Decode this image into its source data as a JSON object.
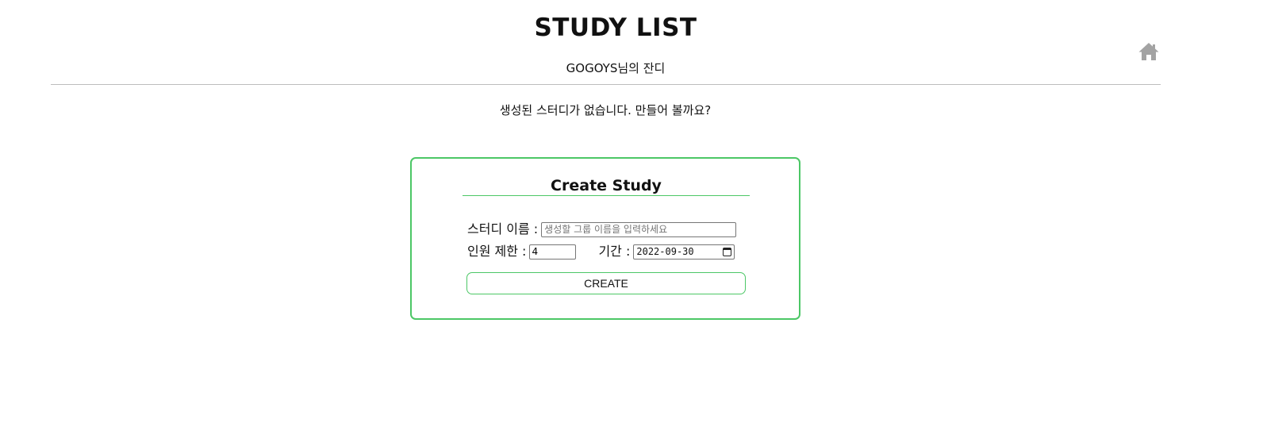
{
  "header": {
    "title": "STUDY LIST",
    "subtitle": "GOGOYS님의 잔디",
    "home_icon": "home-icon"
  },
  "main": {
    "empty_message": "생성된 스터디가 없습니다. 만들어 볼까요?"
  },
  "create_form": {
    "title": "Create Study",
    "name_label": "스터디 이름 :",
    "name_placeholder": "생성할 그룹 이름을 입력하세요",
    "name_value": "",
    "limit_label": "인원 제한 :",
    "limit_value": "4",
    "period_label": "기간 :",
    "period_value": "2022-09-30",
    "calendar_icon": "calendar-icon",
    "submit_label": "CREATE"
  },
  "colors": {
    "accent": "#4cc766",
    "divider": "#bdbdbd",
    "home_icon": "#a3a3a3"
  }
}
